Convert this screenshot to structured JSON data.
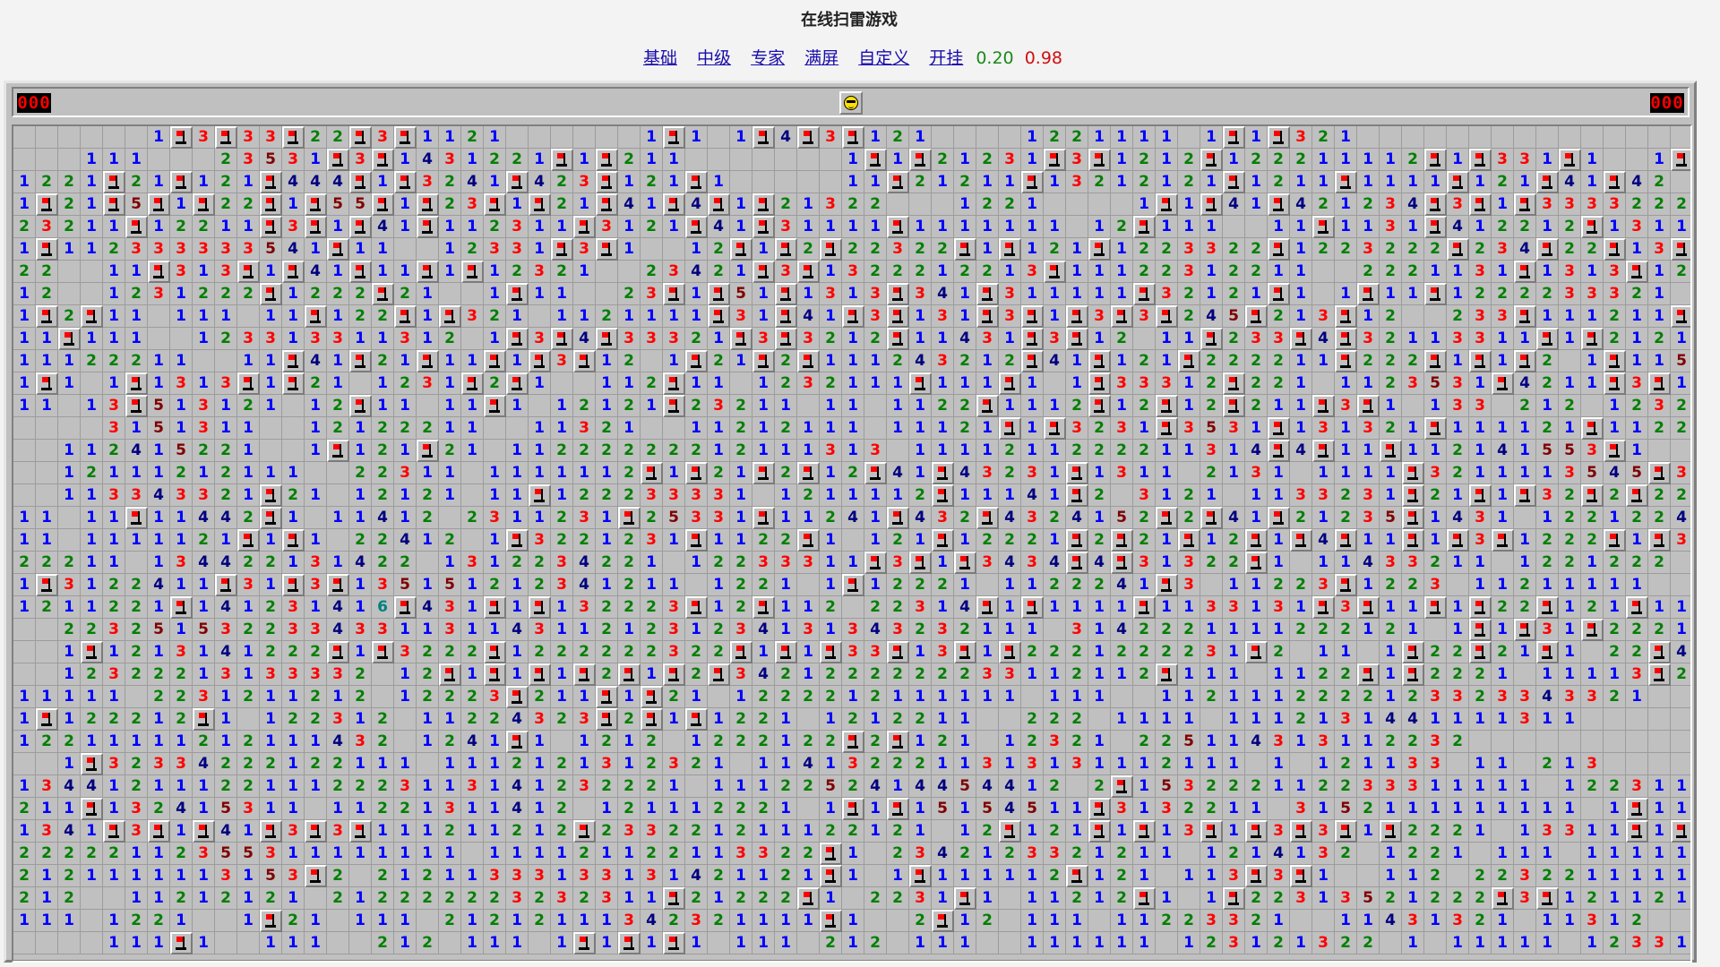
{
  "page": {
    "title": "在线扫雷游戏"
  },
  "nav": {
    "links": [
      "基础",
      "中级",
      "专家",
      "满屏",
      "自定义",
      "开挂"
    ],
    "speed_a": "0.20",
    "speed_b": "0.98"
  },
  "game": {
    "mines_left": "000",
    "timer": "000",
    "face_icon": "smiley-sunglasses-icon",
    "cols": 75,
    "rows": 37,
    "grid": [
      "      1F3F33F22F3F1121      1F1 1F4F3F121    1221111 1F1F321",
      "   111   23531F3F1431221F1F211       1F1F21231F3F1212F122211112F1F331F1  1F1223F1F1",
      "1221F21F121F444F1F3241F423F121F1     11F21211F13212121F1211F1111F121F41F42    1F1   1221",
      "1F21F5F1F22F1F55F1F23F1F21F41F4F1F21322   1221    1F1F41F421234F3F1F33332222F1F12231F21121211",
      "23211F12211F3F1F41F112311F3121F41F31111F1111111 12F111  11F1131F412212F1311F22223F13211",
      "1F112333333541F11  12331F3F1  12F1F2F22322F1F121F1223322F1223222F234F22F13F13322F1F1F23F22   111",
      "22  11F313F1F41F11F1F12321  23421F3F1322212213F11122312211  2221131F1313F122221 1F121F1F11121",
      "12  1231222F1222F21  1F11  23F1F51F1313F341F311111F32121F1 1F11F1222233321  111 1222F1222F1",
      "1F2F11 111 11F122F1F321 1121111F31F41F3F131F3F1F3F3F245F213F12  233F111211F1  1222F1F111313F11121",
      "11F111  123313311312 1F3F4F33321F3F3212F11431F3F12 11F233F4F32113311F1F21212F3F52  12311",
      "11122211  11F41F21F11F1F3F12 1F21F2F111243212F41F121F222211F222F1F1F2 1F1152 1F31F21  1F122",
      "1F1 1F1313F1F21 1231F2F1  112F11 1232111F111F1 1F33312F221 1123531F4211F3F1F1 2F1421  1F112F1",
      "11 13F513121 12F11 11F1 12121F23211 11 1122F1112F12F12F211F3F1 133 212 12321F12",
      "    3151311  12122211  11321  11212111 11121F1F3231F3531F131321F111121F1122",
      "  112415221  1F121F21 11222222212111313 1111211222211314F4F11F112141553F1",
      "  12111212111  22311 1111112F1F21F2F12F41F43231F1311 2131 1111F3211113545F3112121F1F121F32334",
      "  113343321F21 12121 11F122233331 1211112F11141F2 3121 1133231F21F1F32F2F2212F1F3F3F51F1F3",
      "11 11F11442F1 11412 2311231F25331F11241F432F4324152F2F41F21235F1431 1221224F1F51F2",
      "11 1111121F1F1 22412 1F3221231F1122F1 121F12221F2F21F12F1F4F11F1F3F1222F1F312F13312F1 1112121F1",
      "22211 134422131422 1312234221 12233311F3F1F3434F4F31322F1 11433211 1221222",
      "1F3122411F31F3F135151212341211 1221 1F12221 1122241F3 11223F1223 11211111",
      "1211221F141231416F431F1F132223F12F112 22314F1F1111F1133131F3F11F1F22F121F111 1122F1321F1",
      "  22325153223343311311431121231234131343232111 3142221111222121 1F1F31F22211",
      "  1F1213141222F1F3222F1222222322F1F1F33F13F1F2221222231F2 11 1F22F21F1 22F44F1211",
      "  12322213133332 12F1F1F1F2F1F2F3421222222233112112F111 1122F1F2221 11113F21311F1",
      "11111 2231211212 12223F211F1F21 1222212111111 111  1121112222123323343321",
      "1F122212F1 122312 11224323F2F1F1221 1212211  222 1111 1112131441111311",
      "12211111212111432 1241F1 1212 1222122F2F121 12321 225114313112232",
      "  1F32334222122111 1112121312321 1141322211313131112111 1 121133 11 213",
      "134412111221112223113141232221 1112252414454412 2F153222112233311111 122311",
      "211F132415311 11221311412 121112221 1F1F15154511F3132211 3152111111111 1F11432",
      "1341F3F1F41F3F3F111211212F233221211122121 12F121F1F13F1F3F3F1F2221 13311F1F31 222 111 1311",
      "22222112355311111111 111121122113322F1 2342123321211 1214132 1221 111 111111112331",
      "2121111113153F2 21211333133131421121F1 1F111112F121 113F3F1  112 22322111111111",
      "212  11212121 212222223232311F21222F1 2231F1 11212F1 1F22313521222F3F121121111122341",
      "111 1221  1F21 111 21212111342321111F1  2F12 111 11223321  11431321 11312",
      "    111F1  111  212 111 1F1F1F1 111 212 111  111111 123121322 1 11111 12331"
    ]
  }
}
